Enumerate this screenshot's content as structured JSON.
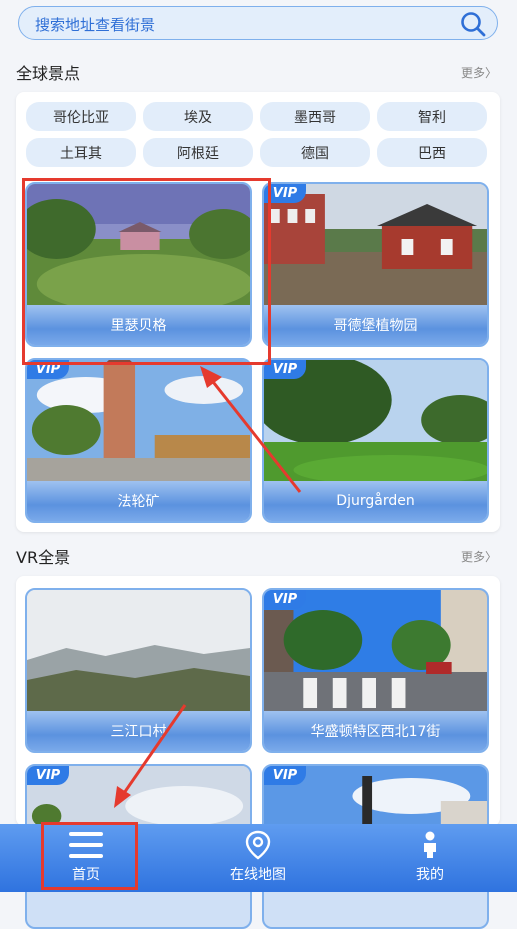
{
  "search": {
    "placeholder": "搜索地址查看街景",
    "icon": "search-icon"
  },
  "global_section": {
    "title": "全球景点",
    "more": "更多〉",
    "countries": [
      "哥伦比亚",
      "埃及",
      "墨西哥",
      "智利",
      "土耳其",
      "阿根廷",
      "德国",
      "巴西"
    ],
    "cards": [
      {
        "label": "里瑟贝格",
        "vip": false
      },
      {
        "label": "哥德堡植物园",
        "vip": true,
        "badge": "VIP"
      },
      {
        "label": "法轮矿",
        "vip": true,
        "badge": "VIP"
      },
      {
        "label": "Djurgården",
        "vip": true,
        "badge": "VIP"
      }
    ]
  },
  "vr_section": {
    "title": "VR全景",
    "more": "更多〉",
    "cards": [
      {
        "label": "三江口村",
        "vip": false
      },
      {
        "label": "华盛顿特区西北17街",
        "vip": true,
        "badge": "VIP"
      },
      {
        "label": "",
        "vip": true,
        "badge": "VIP"
      },
      {
        "label": "",
        "vip": true,
        "badge": "VIP"
      }
    ]
  },
  "tabbar": {
    "items": [
      {
        "label": "首页",
        "icon": "menu-icon"
      },
      {
        "label": "在线地图",
        "icon": "map-pin-icon"
      },
      {
        "label": "我的",
        "icon": "person-icon"
      }
    ]
  },
  "colors": {
    "accent": "#2f73df",
    "annotation": "#e53a2e",
    "chip": "#e2edfa"
  }
}
